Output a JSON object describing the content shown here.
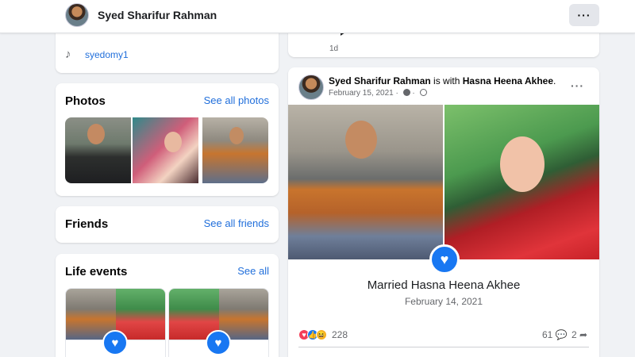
{
  "header": {
    "profile_name": "Syed Sharifur Rahman",
    "more_label": "···"
  },
  "intro": {
    "tiktok_icon": "♪",
    "tiktok_handle": "syedomy1"
  },
  "photos": {
    "title": "Photos",
    "see_all": "See all photos"
  },
  "friends": {
    "title": "Friends",
    "see_all": "See all friends"
  },
  "life_events": {
    "title": "Life events",
    "see_all": "See all",
    "heart_icon": "♥"
  },
  "previous_post": {
    "time": "1d"
  },
  "post": {
    "author": "Syed Sharifur Rahman",
    "with_text": "is with",
    "tagged": "Hasna Heena Akhee",
    "date": "February 15, 2021",
    "separator": "·",
    "more_label": "···",
    "heart_icon": "♥",
    "event_title": "Married Hasna Heena Akhee",
    "event_date": "February 14, 2021",
    "reactions": {
      "love_icon": "♥",
      "like_icon": "👍",
      "haha_icon": "😆",
      "count": "228"
    },
    "comments": "61 💬",
    "shares": "2 ➦"
  },
  "colors": {
    "accent": "#1877f2",
    "link": "#216fdb",
    "background": "#f0f2f5"
  }
}
